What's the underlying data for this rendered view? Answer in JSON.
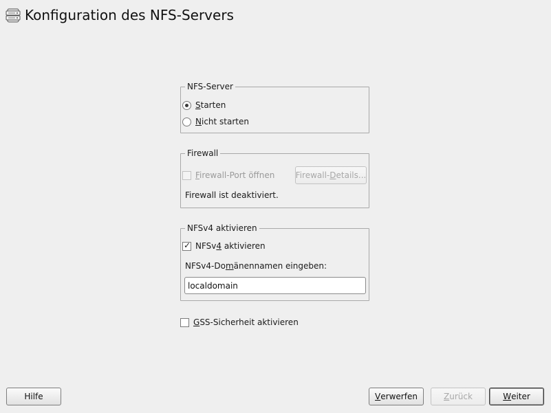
{
  "window": {
    "title": "Konfiguration des NFS-Servers",
    "icon": "server-icon"
  },
  "nfs_server": {
    "legend": "NFS-Server",
    "options": [
      {
        "pre": "",
        "mnemonic": "S",
        "post": "tarten",
        "selected": true
      },
      {
        "pre": "",
        "mnemonic": "N",
        "post": "icht starten",
        "selected": false
      }
    ]
  },
  "firewall": {
    "legend": "Firewall",
    "port_checkbox": {
      "pre": "",
      "mnemonic": "F",
      "post": "irewall-Port öffnen",
      "checked": false,
      "enabled": false
    },
    "details_button": {
      "pre": "Firewall-",
      "mnemonic": "D",
      "post": "etails...",
      "enabled": false
    },
    "status_text": "Firewall ist deaktiviert."
  },
  "nfsv4": {
    "legend": "NFSv4 aktivieren",
    "checkbox": {
      "pre": "NFSv",
      "mnemonic": "4",
      "post": " aktivieren",
      "checked": true
    },
    "domain_label": {
      "pre": "NFSv4-Do",
      "mnemonic": "m",
      "post": "änennamen eingeben:"
    },
    "domain_value": "localdomain"
  },
  "gss": {
    "pre": "",
    "mnemonic": "G",
    "post": "SS-Sicherheit aktivieren",
    "checked": false
  },
  "buttons": {
    "help": "Hilfe",
    "discard": {
      "pre": "",
      "mnemonic": "V",
      "post": "erwerfen"
    },
    "back": {
      "pre": "",
      "mnemonic": "Z",
      "post": "urück",
      "enabled": false
    },
    "next": {
      "pre": "",
      "mnemonic": "W",
      "post": "eiter"
    }
  }
}
